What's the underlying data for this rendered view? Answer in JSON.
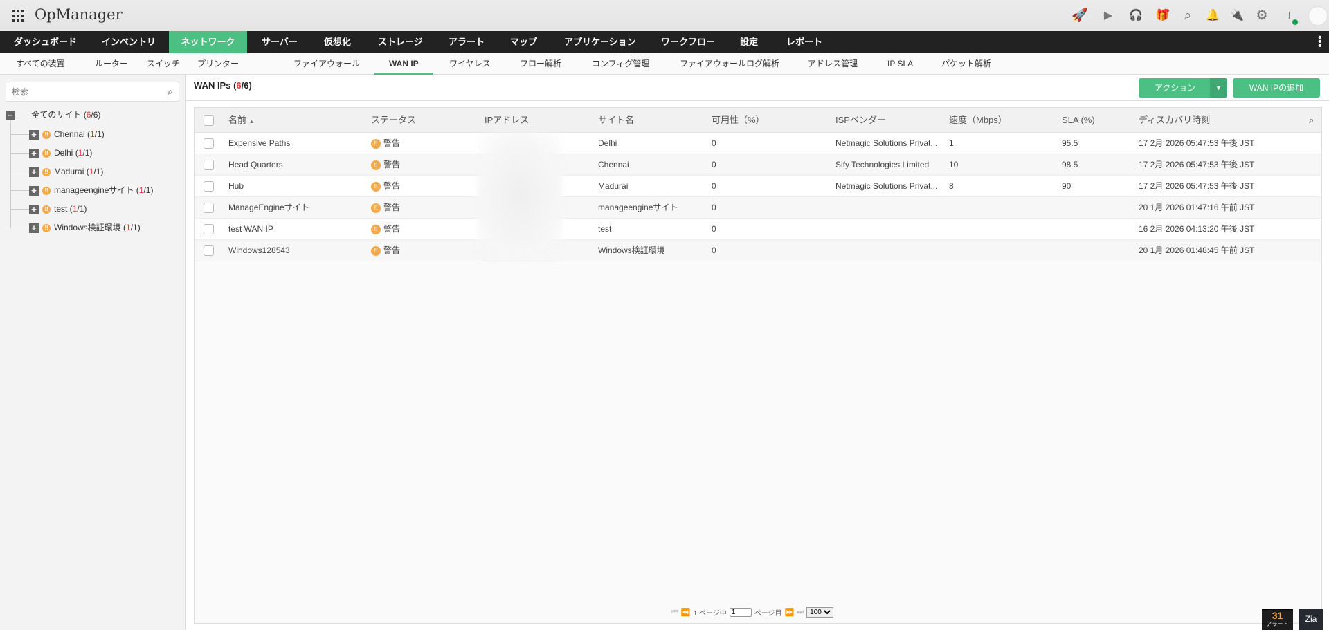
{
  "app": {
    "title": "OpManager"
  },
  "top_icons": [
    "rocket-icon",
    "presentation-icon",
    "headset-icon",
    "gift-icon",
    "search-icon",
    "bell-icon",
    "plug-icon",
    "gear-icon",
    "shield-alert-icon",
    "avatar-icon"
  ],
  "main_nav": [
    "ダッシュボード",
    "インベントリ",
    "ネットワーク",
    "サーバー",
    "仮想化",
    "ストレージ",
    "アラート",
    "マップ",
    "アプリケーション",
    "ワークフロー",
    "設定",
    "レポート"
  ],
  "sub_nav": [
    "すべての装置",
    "ルーター",
    "スイッチ",
    "プリンター",
    "ファイアウォール",
    "WAN IP",
    "ワイヤレス",
    "フロー解析",
    "コンフィグ管理",
    "ファイアウォールログ解析",
    "アドレス管理",
    "IP SLA",
    "パケット解析"
  ],
  "sidebar": {
    "search_placeholder": "検索",
    "root": {
      "label": "全てのサイト",
      "count": "6",
      "total": "/6"
    },
    "sites": [
      {
        "label": "Chennai",
        "count": "1",
        "total": "/1"
      },
      {
        "label": "Delhi",
        "count": "1",
        "total": "/1"
      },
      {
        "label": "Madurai",
        "count": "1",
        "total": "/1"
      },
      {
        "label": "manageengineサイト",
        "count": "1",
        "total": "/1"
      },
      {
        "label": "test",
        "count": "1",
        "total": "/1"
      },
      {
        "label": "Windows検証環境",
        "count": "1",
        "total": "/1"
      }
    ]
  },
  "page": {
    "title": "WAN IPs",
    "count": "6",
    "total": "/6",
    "action_label": "アクション",
    "add_label": "WAN IPの追加"
  },
  "table": {
    "columns": [
      "名前",
      "ステータス",
      "IPアドレス",
      "サイト名",
      "可用性（%）",
      "ISPベンダー",
      "速度（Mbps）",
      "SLA (%)",
      "ディスカバリ時刻"
    ],
    "rows": [
      {
        "name": "Expensive Paths",
        "status": "警告",
        "site": "Delhi",
        "avail": "0",
        "isp": "Netmagic Solutions Privat...",
        "speed": "1",
        "sla": "95.5",
        "time": "17 2月 2026 05:47:53 午後 JST"
      },
      {
        "name": "Head Quarters",
        "status": "警告",
        "site": "Chennai",
        "avail": "0",
        "isp": "Sify Technologies Limited",
        "speed": "10",
        "sla": "98.5",
        "time": "17 2月 2026 05:47:53 午後 JST"
      },
      {
        "name": "Hub",
        "status": "警告",
        "site": "Madurai",
        "avail": "0",
        "isp": "Netmagic Solutions Privat...",
        "speed": "8",
        "sla": "90",
        "time": "17 2月 2026 05:47:53 午後 JST"
      },
      {
        "name": "ManageEngineサイト",
        "status": "警告",
        "site": "manageengineサイト",
        "avail": "0",
        "isp": "",
        "speed": "",
        "sla": "",
        "time": "20 1月 2026 01:47:16 午前 JST"
      },
      {
        "name": "test WAN IP",
        "status": "警告",
        "site": "test",
        "avail": "0",
        "isp": "",
        "speed": "",
        "sla": "",
        "time": "16 2月 2026 04:13:20 午後 JST"
      },
      {
        "name": "Windows128543",
        "status": "警告",
        "site": "Windows検証環境",
        "avail": "0",
        "isp": "",
        "speed": "",
        "sla": "",
        "time": "20 1月 2026 01:48:45 午前 JST"
      }
    ]
  },
  "pager": {
    "of_label": "1 ページ中",
    "page": "1",
    "page_label": "ページ目",
    "per_page": "100"
  },
  "alerts": {
    "count": "31",
    "label": "アラート"
  },
  "zia": {
    "label": "Zia"
  }
}
